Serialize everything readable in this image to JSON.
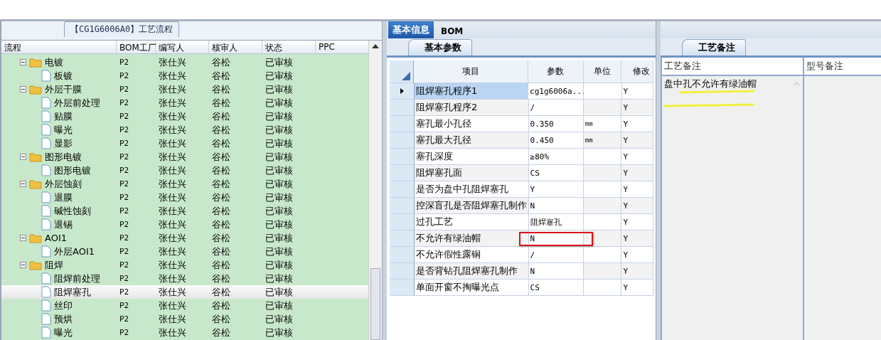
{
  "process_panel": {
    "title": "【CG1G6006A0】工艺流程",
    "columns": [
      "流程",
      "BOM工厂",
      "编写人",
      "核审人",
      "状态",
      "PPC"
    ],
    "tree": [
      {
        "name": "电镀",
        "kind": "folder",
        "expanded": true,
        "selected": false,
        "bom": "P2",
        "writer": "张仕兴",
        "reviewer": "谷松",
        "status": "已审核",
        "children": [
          {
            "name": "板镀",
            "kind": "file",
            "selected": false,
            "bom": "P2",
            "writer": "张仕兴",
            "reviewer": "谷松",
            "status": "已审核"
          }
        ]
      },
      {
        "name": "外层干膜",
        "kind": "folder",
        "expanded": true,
        "selected": false,
        "bom": "P2",
        "writer": "张仕兴",
        "reviewer": "谷松",
        "status": "已审核",
        "children": [
          {
            "name": "外层前处理",
            "kind": "file",
            "selected": false,
            "bom": "P2",
            "writer": "张仕兴",
            "reviewer": "谷松",
            "status": "已审核"
          },
          {
            "name": "贴膜",
            "kind": "file",
            "selected": false,
            "bom": "P2",
            "writer": "张仕兴",
            "reviewer": "谷松",
            "status": "已审核"
          },
          {
            "name": "曝光",
            "kind": "file",
            "selected": false,
            "bom": "P2",
            "writer": "张仕兴",
            "reviewer": "谷松",
            "status": "已审核"
          },
          {
            "name": "显影",
            "kind": "file",
            "selected": false,
            "bom": "P2",
            "writer": "张仕兴",
            "reviewer": "谷松",
            "status": "已审核"
          }
        ]
      },
      {
        "name": "图形电镀",
        "kind": "folder",
        "expanded": true,
        "selected": false,
        "bom": "P2",
        "writer": "张仕兴",
        "reviewer": "谷松",
        "status": "已审核",
        "children": [
          {
            "name": "图形电镀",
            "kind": "file",
            "selected": false,
            "bom": "P2",
            "writer": "张仕兴",
            "reviewer": "谷松",
            "status": "已审核"
          }
        ]
      },
      {
        "name": "外层蚀刻",
        "kind": "folder",
        "expanded": true,
        "selected": false,
        "bom": "P2",
        "writer": "张仕兴",
        "reviewer": "谷松",
        "status": "已审核",
        "children": [
          {
            "name": "退膜",
            "kind": "file",
            "selected": false,
            "bom": "P2",
            "writer": "张仕兴",
            "reviewer": "谷松",
            "status": "已审核"
          },
          {
            "name": "碱性蚀刻",
            "kind": "file",
            "selected": false,
            "bom": "P2",
            "writer": "张仕兴",
            "reviewer": "谷松",
            "status": "已审核"
          },
          {
            "name": "退锡",
            "kind": "file",
            "selected": false,
            "bom": "P2",
            "writer": "张仕兴",
            "reviewer": "谷松",
            "status": "已审核"
          }
        ]
      },
      {
        "name": "AOI1",
        "kind": "folder",
        "expanded": true,
        "selected": false,
        "bom": "P2",
        "writer": "张仕兴",
        "reviewer": "谷松",
        "status": "已审核",
        "children": [
          {
            "name": "外层AOI1",
            "kind": "file",
            "selected": false,
            "bom": "P2",
            "writer": "张仕兴",
            "reviewer": "谷松",
            "status": "已审核"
          }
        ]
      },
      {
        "name": "阻焊",
        "kind": "folder",
        "expanded": true,
        "selected": false,
        "bom": "P2",
        "writer": "张仕兴",
        "reviewer": "谷松",
        "status": "已审核",
        "children": [
          {
            "name": "阻焊前处理",
            "kind": "file",
            "selected": false,
            "bom": "P2",
            "writer": "张仕兴",
            "reviewer": "谷松",
            "status": "已审核"
          },
          {
            "name": "阻焊塞孔",
            "kind": "file",
            "selected": true,
            "bom": "P2",
            "writer": "张仕兴",
            "reviewer": "谷松",
            "status": "已审核"
          },
          {
            "name": "丝印",
            "kind": "file",
            "selected": false,
            "bom": "P2",
            "writer": "张仕兴",
            "reviewer": "谷松",
            "status": "已审核"
          },
          {
            "name": "预烘",
            "kind": "file",
            "selected": false,
            "bom": "P2",
            "writer": "张仕兴",
            "reviewer": "谷松",
            "status": "已审核"
          },
          {
            "name": "曝光",
            "kind": "file",
            "selected": false,
            "bom": "P2",
            "writer": "张仕兴",
            "reviewer": "谷松",
            "status": "已审核"
          }
        ]
      }
    ]
  },
  "info_panel": {
    "tabs": [
      {
        "label": "基本信息",
        "selected": true
      },
      {
        "label": "BOM",
        "selected": false
      }
    ],
    "subtab": "基本参数",
    "columns": [
      "项目",
      "参数",
      "单位",
      "修改"
    ],
    "rows": [
      {
        "item": "阻焊塞孔程序1",
        "param": "cg1g6006a...",
        "unit": "",
        "modified": "Y",
        "selected": true,
        "highlighted": false
      },
      {
        "item": "阻焊塞孔程序2",
        "param": "/",
        "unit": "",
        "modified": "Y",
        "selected": false,
        "highlighted": false
      },
      {
        "item": "塞孔最小孔径",
        "param": "0.350",
        "unit": "mm",
        "modified": "Y",
        "selected": false,
        "highlighted": false
      },
      {
        "item": "塞孔最大孔径",
        "param": "0.450",
        "unit": "mm",
        "modified": "Y",
        "selected": false,
        "highlighted": false
      },
      {
        "item": "塞孔深度",
        "param": "≥80%",
        "unit": "",
        "modified": "Y",
        "selected": false,
        "highlighted": false
      },
      {
        "item": "阻焊塞孔面",
        "param": "CS",
        "unit": "",
        "modified": "Y",
        "selected": false,
        "highlighted": false
      },
      {
        "item": "是否为盘中孔阻焊塞孔",
        "param": "Y",
        "unit": "",
        "modified": "Y",
        "selected": false,
        "highlighted": false
      },
      {
        "item": "控深盲孔是否阻焊塞孔制作",
        "param": "N",
        "unit": "",
        "modified": "Y",
        "selected": false,
        "highlighted": false
      },
      {
        "item": "过孔工艺",
        "param": "阻焊塞孔",
        "unit": "",
        "modified": "Y",
        "selected": false,
        "highlighted": false
      },
      {
        "item": "不允许有绿油帽",
        "param": "N",
        "unit": "",
        "modified": "Y",
        "selected": false,
        "highlighted": true
      },
      {
        "item": "不允许假性露铜",
        "param": "/",
        "unit": "",
        "modified": "Y",
        "selected": false,
        "highlighted": false
      },
      {
        "item": "是否背钻孔阻焊塞孔制作",
        "param": "N",
        "unit": "",
        "modified": "Y",
        "selected": false,
        "highlighted": false
      },
      {
        "item": "单面开窗不掏曝光点",
        "param": "CS",
        "unit": "",
        "modified": "Y",
        "selected": false,
        "highlighted": false
      }
    ]
  },
  "notes_panel": {
    "tab": "工艺备注",
    "columns": [
      "工艺备注",
      "型号备注"
    ],
    "process_note": "盘中孔不允许有绿油帽",
    "underlined": true
  }
}
